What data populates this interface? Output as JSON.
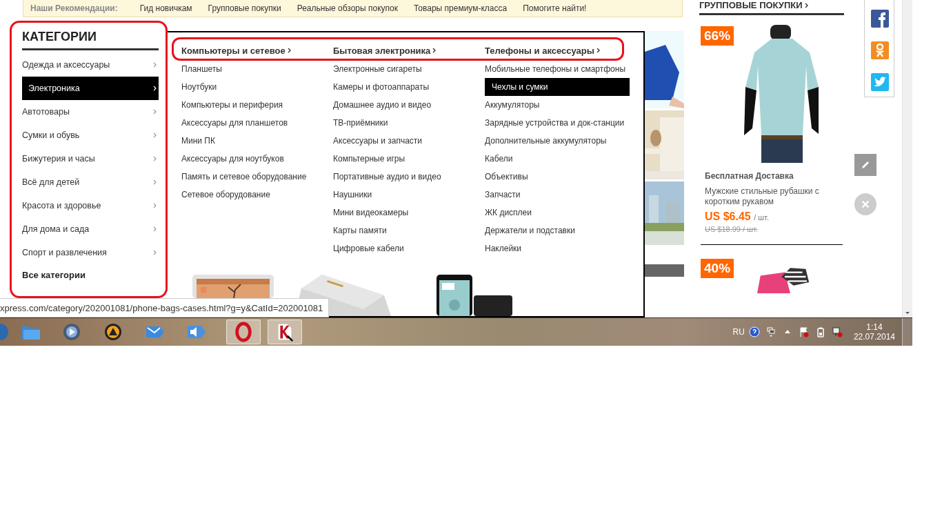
{
  "recommendations": {
    "label": "Наши Рекомендации:",
    "links": [
      "Гид новичкам",
      "Групповые покупки",
      "Реальные обзоры покупок",
      "Товары премиум-класса",
      "Помогите найти!"
    ]
  },
  "categories": {
    "title": "КАТЕГОРИИ",
    "items": [
      {
        "label": "Одежда и аксессуары",
        "selected": false
      },
      {
        "label": "Электроника",
        "selected": true
      },
      {
        "label": "Автотовары",
        "selected": false
      },
      {
        "label": "Сумки и обувь",
        "selected": false
      },
      {
        "label": "Бижутерия и часы",
        "selected": false
      },
      {
        "label": "Всё для детей",
        "selected": false
      },
      {
        "label": "Красота и здоровье",
        "selected": false
      },
      {
        "label": "Для дома и сада",
        "selected": false
      },
      {
        "label": "Спорт и развлечения",
        "selected": false
      }
    ],
    "all": "Все категории"
  },
  "menu": {
    "columns": [
      {
        "title": "Компьютеры и сетевое",
        "items": [
          {
            "label": "Планшеты",
            "selected": false
          },
          {
            "label": "Ноутбуки",
            "selected": false
          },
          {
            "label": "Компьютеры и периферия",
            "selected": false
          },
          {
            "label": "Аксессуары для планшетов",
            "selected": false
          },
          {
            "label": "Мини ПК",
            "selected": false
          },
          {
            "label": "Аксессуары для ноутбуков",
            "selected": false
          },
          {
            "label": "Память и сетевое оборудование",
            "selected": false
          },
          {
            "label": "Сетевое оборудование",
            "selected": false
          }
        ]
      },
      {
        "title": "Бытовая электроника",
        "items": [
          {
            "label": "Электронные сигареты",
            "selected": false
          },
          {
            "label": "Камеры и фотоаппараты",
            "selected": false
          },
          {
            "label": "Домашнее аудио и видео",
            "selected": false
          },
          {
            "label": "ТВ-приёмники",
            "selected": false
          },
          {
            "label": "Аксессуары и запчасти",
            "selected": false
          },
          {
            "label": "Компьтерные игры",
            "selected": false
          },
          {
            "label": "Портативные аудио и видео",
            "selected": false
          },
          {
            "label": "Наушники",
            "selected": false
          },
          {
            "label": "Мини видеокамеры",
            "selected": false
          },
          {
            "label": "Карты памяти",
            "selected": false
          },
          {
            "label": "Цифровые кабели",
            "selected": false
          }
        ]
      },
      {
        "title": "Телефоны и аксессуары",
        "items": [
          {
            "label": "Мобильные телефоны и смартфоны",
            "selected": false
          },
          {
            "label": "Чехлы и сумки",
            "selected": true
          },
          {
            "label": "Аккумуляторы",
            "selected": false
          },
          {
            "label": "Зарядные устройства и док-станции",
            "selected": false
          },
          {
            "label": "Дополнительные аккумуляторы",
            "selected": false
          },
          {
            "label": "Кабели",
            "selected": false
          },
          {
            "label": "Объективы",
            "selected": false
          },
          {
            "label": "Запчасти",
            "selected": false
          },
          {
            "label": "ЖК дисплеи",
            "selected": false
          },
          {
            "label": "Держатели и подставки",
            "selected": false
          },
          {
            "label": "Наклейки",
            "selected": false
          }
        ]
      }
    ]
  },
  "deals": {
    "title": "ГРУППОВЫЕ ПОКУПКИ",
    "items": [
      {
        "discount": "66%",
        "shipping": "Бесплатная Доставка",
        "name": "Мужские стильные рубашки с коротким рукавом",
        "price": "US $6.45",
        "unit": "/ шт.",
        "old_price": "US $18.99 / шт."
      },
      {
        "discount": "40%"
      }
    ]
  },
  "status_url": "xpress.com/category/202001081/phone-bags-cases.html?g=y&CatId=202001081",
  "taskbar": {
    "language": "RU",
    "time": "1:14",
    "date": "22.07.2014"
  }
}
